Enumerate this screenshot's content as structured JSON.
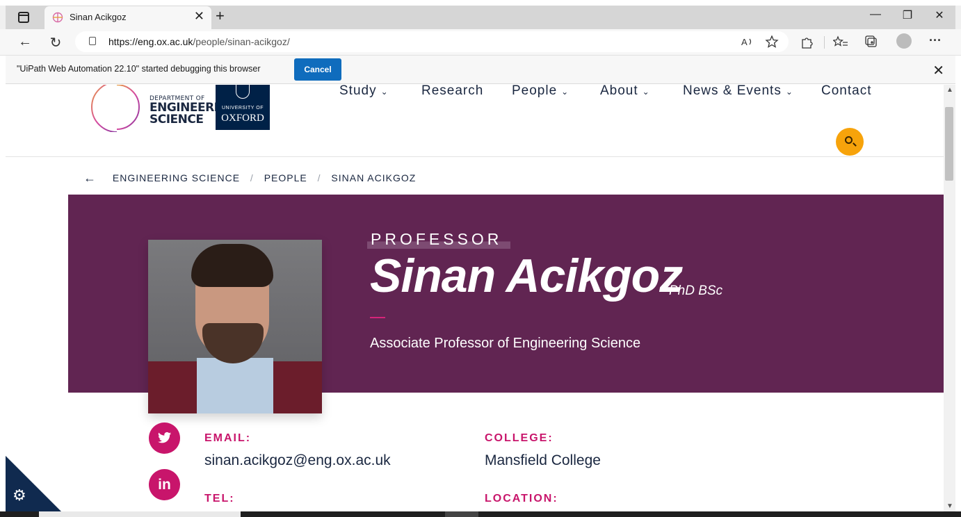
{
  "browser": {
    "tab_title": "Sinan Acikgoz",
    "new_tab": "+",
    "tab_close": "✕",
    "url_host": "https://eng.ox.ac.uk",
    "url_path": "/people/sinan-acikgoz/",
    "window_controls": {
      "minimize": "—",
      "restore": "❐",
      "close": "✕"
    },
    "nav": {
      "back": "←",
      "reload": "↻"
    },
    "toolbar_icons": [
      "read-aloud-icon",
      "favorite-add-icon",
      "extensions-icon",
      "favorites-icon",
      "collections-icon",
      "profile-icon",
      "more-icon"
    ],
    "infobar": {
      "message": "\"UiPath Web Automation 22.10\" started debugging this browser",
      "cancel_label": "Cancel",
      "close": "✕"
    }
  },
  "site": {
    "dept_small": "DEPARTMENT OF",
    "dept_line1": "ENGINEERING",
    "dept_line2": "SCIENCE",
    "oxford_small": "UNIVERSITY OF",
    "oxford_big": "OXFORD",
    "nav": [
      {
        "label": "Study",
        "caret": "⌄"
      },
      {
        "label": "Research",
        "caret": ""
      },
      {
        "label": "People",
        "caret": "⌄"
      },
      {
        "label": "About",
        "caret": "⌄"
      },
      {
        "label": "News & Events",
        "caret": "⌄"
      },
      {
        "label": "Contact",
        "caret": ""
      }
    ],
    "accent_color": "#f7a30b"
  },
  "breadcrumb": {
    "back": "←",
    "items": [
      "ENGINEERING SCIENCE",
      "PEOPLE",
      "SINAN ACIKGOZ"
    ],
    "separator": "/"
  },
  "profile": {
    "role": "PROFESSOR",
    "name": "Sinan Acikgoz",
    "qualifications": "PhD BSc",
    "position": "Associate Professor of Engineering Science",
    "hero_color": "#612552",
    "accent_color": "#c8156b",
    "social": [
      {
        "name": "twitter",
        "glyph": "🐦"
      },
      {
        "name": "linkedin",
        "glyph": "in"
      }
    ],
    "contact": {
      "email_label": "EMAIL:",
      "email": "sinan.acikgoz@eng.ox.ac.uk",
      "college_label": "COLLEGE:",
      "college": "Mansfield College",
      "tel_label": "TEL:",
      "location_label": "LOCATION:"
    }
  },
  "cookie_icon": "⚙"
}
